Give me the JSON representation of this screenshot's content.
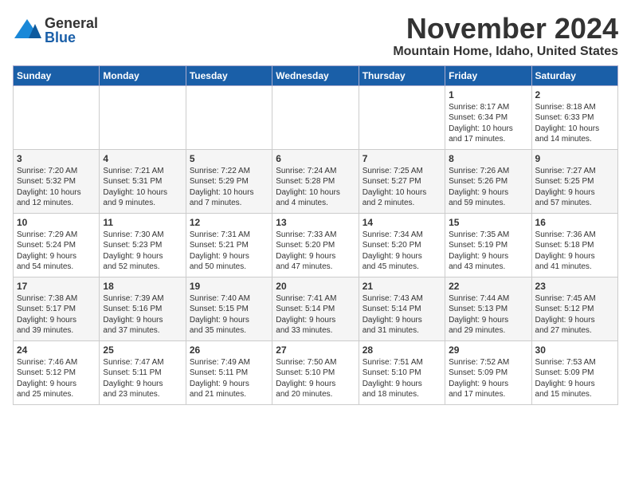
{
  "header": {
    "logo_line1": "General",
    "logo_line2": "Blue",
    "month_title": "November 2024",
    "location": "Mountain Home, Idaho, United States"
  },
  "weekdays": [
    "Sunday",
    "Monday",
    "Tuesday",
    "Wednesday",
    "Thursday",
    "Friday",
    "Saturday"
  ],
  "weeks": [
    [
      {
        "day": "",
        "info": ""
      },
      {
        "day": "",
        "info": ""
      },
      {
        "day": "",
        "info": ""
      },
      {
        "day": "",
        "info": ""
      },
      {
        "day": "",
        "info": ""
      },
      {
        "day": "1",
        "info": "Sunrise: 8:17 AM\nSunset: 6:34 PM\nDaylight: 10 hours\nand 17 minutes."
      },
      {
        "day": "2",
        "info": "Sunrise: 8:18 AM\nSunset: 6:33 PM\nDaylight: 10 hours\nand 14 minutes."
      }
    ],
    [
      {
        "day": "3",
        "info": "Sunrise: 7:20 AM\nSunset: 5:32 PM\nDaylight: 10 hours\nand 12 minutes."
      },
      {
        "day": "4",
        "info": "Sunrise: 7:21 AM\nSunset: 5:31 PM\nDaylight: 10 hours\nand 9 minutes."
      },
      {
        "day": "5",
        "info": "Sunrise: 7:22 AM\nSunset: 5:29 PM\nDaylight: 10 hours\nand 7 minutes."
      },
      {
        "day": "6",
        "info": "Sunrise: 7:24 AM\nSunset: 5:28 PM\nDaylight: 10 hours\nand 4 minutes."
      },
      {
        "day": "7",
        "info": "Sunrise: 7:25 AM\nSunset: 5:27 PM\nDaylight: 10 hours\nand 2 minutes."
      },
      {
        "day": "8",
        "info": "Sunrise: 7:26 AM\nSunset: 5:26 PM\nDaylight: 9 hours\nand 59 minutes."
      },
      {
        "day": "9",
        "info": "Sunrise: 7:27 AM\nSunset: 5:25 PM\nDaylight: 9 hours\nand 57 minutes."
      }
    ],
    [
      {
        "day": "10",
        "info": "Sunrise: 7:29 AM\nSunset: 5:24 PM\nDaylight: 9 hours\nand 54 minutes."
      },
      {
        "day": "11",
        "info": "Sunrise: 7:30 AM\nSunset: 5:23 PM\nDaylight: 9 hours\nand 52 minutes."
      },
      {
        "day": "12",
        "info": "Sunrise: 7:31 AM\nSunset: 5:21 PM\nDaylight: 9 hours\nand 50 minutes."
      },
      {
        "day": "13",
        "info": "Sunrise: 7:33 AM\nSunset: 5:20 PM\nDaylight: 9 hours\nand 47 minutes."
      },
      {
        "day": "14",
        "info": "Sunrise: 7:34 AM\nSunset: 5:20 PM\nDaylight: 9 hours\nand 45 minutes."
      },
      {
        "day": "15",
        "info": "Sunrise: 7:35 AM\nSunset: 5:19 PM\nDaylight: 9 hours\nand 43 minutes."
      },
      {
        "day": "16",
        "info": "Sunrise: 7:36 AM\nSunset: 5:18 PM\nDaylight: 9 hours\nand 41 minutes."
      }
    ],
    [
      {
        "day": "17",
        "info": "Sunrise: 7:38 AM\nSunset: 5:17 PM\nDaylight: 9 hours\nand 39 minutes."
      },
      {
        "day": "18",
        "info": "Sunrise: 7:39 AM\nSunset: 5:16 PM\nDaylight: 9 hours\nand 37 minutes."
      },
      {
        "day": "19",
        "info": "Sunrise: 7:40 AM\nSunset: 5:15 PM\nDaylight: 9 hours\nand 35 minutes."
      },
      {
        "day": "20",
        "info": "Sunrise: 7:41 AM\nSunset: 5:14 PM\nDaylight: 9 hours\nand 33 minutes."
      },
      {
        "day": "21",
        "info": "Sunrise: 7:43 AM\nSunset: 5:14 PM\nDaylight: 9 hours\nand 31 minutes."
      },
      {
        "day": "22",
        "info": "Sunrise: 7:44 AM\nSunset: 5:13 PM\nDaylight: 9 hours\nand 29 minutes."
      },
      {
        "day": "23",
        "info": "Sunrise: 7:45 AM\nSunset: 5:12 PM\nDaylight: 9 hours\nand 27 minutes."
      }
    ],
    [
      {
        "day": "24",
        "info": "Sunrise: 7:46 AM\nSunset: 5:12 PM\nDaylight: 9 hours\nand 25 minutes."
      },
      {
        "day": "25",
        "info": "Sunrise: 7:47 AM\nSunset: 5:11 PM\nDaylight: 9 hours\nand 23 minutes."
      },
      {
        "day": "26",
        "info": "Sunrise: 7:49 AM\nSunset: 5:11 PM\nDaylight: 9 hours\nand 21 minutes."
      },
      {
        "day": "27",
        "info": "Sunrise: 7:50 AM\nSunset: 5:10 PM\nDaylight: 9 hours\nand 20 minutes."
      },
      {
        "day": "28",
        "info": "Sunrise: 7:51 AM\nSunset: 5:10 PM\nDaylight: 9 hours\nand 18 minutes."
      },
      {
        "day": "29",
        "info": "Sunrise: 7:52 AM\nSunset: 5:09 PM\nDaylight: 9 hours\nand 17 minutes."
      },
      {
        "day": "30",
        "info": "Sunrise: 7:53 AM\nSunset: 5:09 PM\nDaylight: 9 hours\nand 15 minutes."
      }
    ]
  ]
}
